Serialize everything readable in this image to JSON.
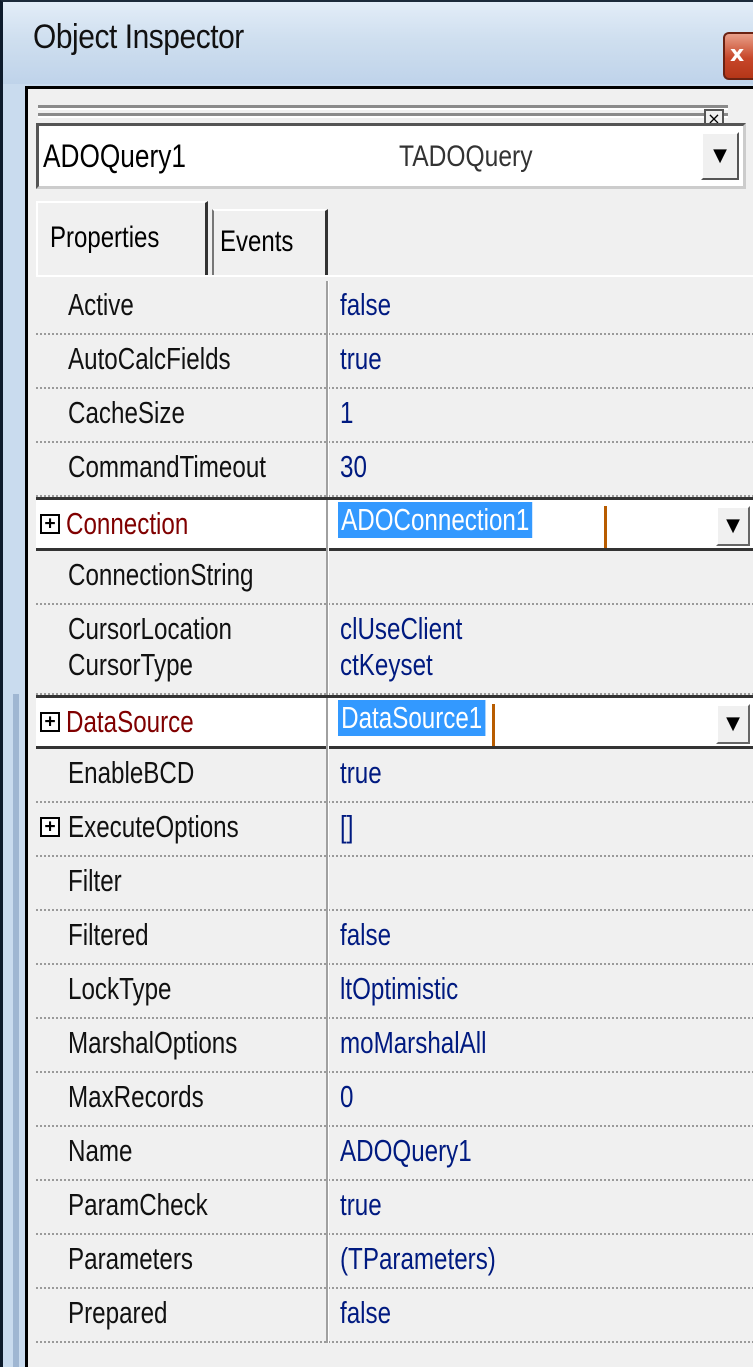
{
  "window": {
    "title": "Object Inspector",
    "close_glyph": "x",
    "close_icon": "close-icon"
  },
  "selector": {
    "object_name": "ADOQuery1",
    "object_type": "TADOQuery",
    "dropdown_icon": "chevron-down-icon"
  },
  "tabs": [
    {
      "label": "Properties",
      "active": true
    },
    {
      "label": "Events",
      "active": false
    }
  ],
  "properties": [
    {
      "name": "Active",
      "value": "false"
    },
    {
      "name": "AutoCalcFields",
      "value": "true"
    },
    {
      "name": "CacheSize",
      "value": "1"
    },
    {
      "name": "CommandTimeout",
      "value": "30"
    },
    {
      "name": "Connection",
      "value": "ADOConnection1",
      "expandable": true,
      "reference": true,
      "selected": true,
      "dropdown": true
    },
    {
      "name": "ConnectionString",
      "value": ""
    },
    {
      "name": "CursorLocation",
      "value": "clUseClient"
    },
    {
      "name": "CursorType",
      "value": "ctKeyset"
    },
    {
      "name": "DataSource",
      "value": "DataSource1",
      "expandable": true,
      "reference": true,
      "selected": true,
      "dropdown": true
    },
    {
      "name": "EnableBCD",
      "value": "true"
    },
    {
      "name": "ExecuteOptions",
      "value": "[]",
      "expandable": true
    },
    {
      "name": "Filter",
      "value": ""
    },
    {
      "name": "Filtered",
      "value": "false"
    },
    {
      "name": "LockType",
      "value": "ltOptimistic"
    },
    {
      "name": "MarshalOptions",
      "value": "moMarshalAll"
    },
    {
      "name": "MaxRecords",
      "value": "0"
    },
    {
      "name": "Name",
      "value": "ADOQuery1"
    },
    {
      "name": "ParamCheck",
      "value": "true"
    },
    {
      "name": "Parameters",
      "value": "(TParameters)"
    },
    {
      "name": "Prepared",
      "value": "false"
    }
  ],
  "glyphs": {
    "expand": "+",
    "dropdown": "▼"
  },
  "colors": {
    "title_bg": "#cfdfef",
    "reference_name": "#800000",
    "value_text": "#001a80",
    "selection": "#3399ff"
  }
}
